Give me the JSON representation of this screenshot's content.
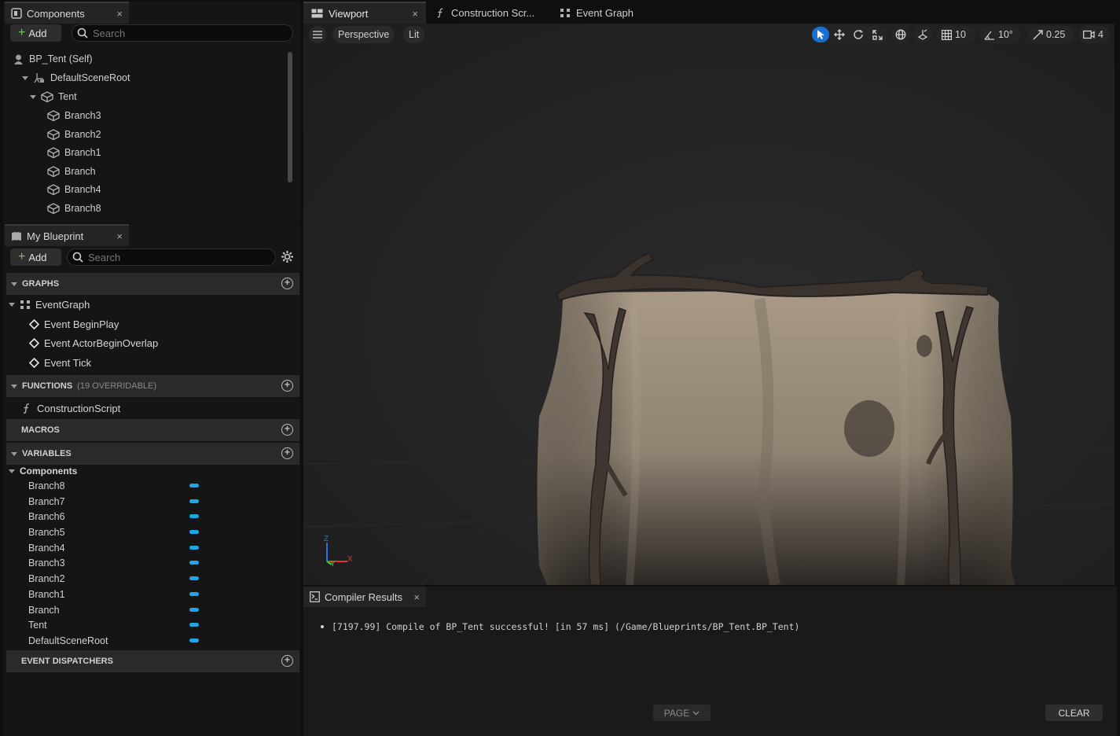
{
  "components_panel": {
    "tab_label": "Components",
    "close": "×",
    "add_label": "Add",
    "search_placeholder": "Search",
    "tree": {
      "root": "BP_Tent (Self)",
      "scene_root": "DefaultSceneRoot",
      "tent": "Tent",
      "children": [
        "Branch3",
        "Branch2",
        "Branch1",
        "Branch",
        "Branch4",
        "Branch8"
      ]
    }
  },
  "my_blueprint": {
    "tab_label": "My Blueprint",
    "close": "×",
    "add_label": "Add",
    "search_placeholder": "Search",
    "graphs": {
      "title": "GRAPHS",
      "event_graph": "EventGraph",
      "events": [
        "Event BeginPlay",
        "Event ActorBeginOverlap",
        "Event Tick"
      ]
    },
    "functions": {
      "title": "FUNCTIONS",
      "overridable": "(19 OVERRIDABLE)",
      "items": [
        "ConstructionScript"
      ]
    },
    "macros": {
      "title": "MACROS"
    },
    "variables": {
      "title": "VARIABLES",
      "group": "Components",
      "items": [
        "Branch8",
        "Branch7",
        "Branch6",
        "Branch5",
        "Branch4",
        "Branch3",
        "Branch2",
        "Branch1",
        "Branch",
        "Tent",
        "DefaultSceneRoot"
      ],
      "pill_color": "#1ea7e8"
    },
    "dispatchers": {
      "title": "EVENT DISPATCHERS"
    }
  },
  "editor_tabs": {
    "viewport": "Viewport",
    "viewport_close": "×",
    "construction": "Construction Scr...",
    "event_graph": "Event Graph"
  },
  "viewport_toolbar": {
    "perspective": "Perspective",
    "lit": "Lit",
    "grid_snap": "10",
    "rotation_snap": "10°",
    "scale_snap": "0.25",
    "camera_speed": "4",
    "active_color": "#1a6ed8"
  },
  "axis_gizmo": {
    "x": "X",
    "y": "Y",
    "z": "Z"
  },
  "compiler_results": {
    "tab_label": "Compiler Results",
    "close": "×",
    "message": "[7197.99] Compile of BP_Tent successful! [in 57 ms] (/Game/Blueprints/BP_Tent.BP_Tent)",
    "page_label": "PAGE",
    "clear_label": "CLEAR"
  }
}
